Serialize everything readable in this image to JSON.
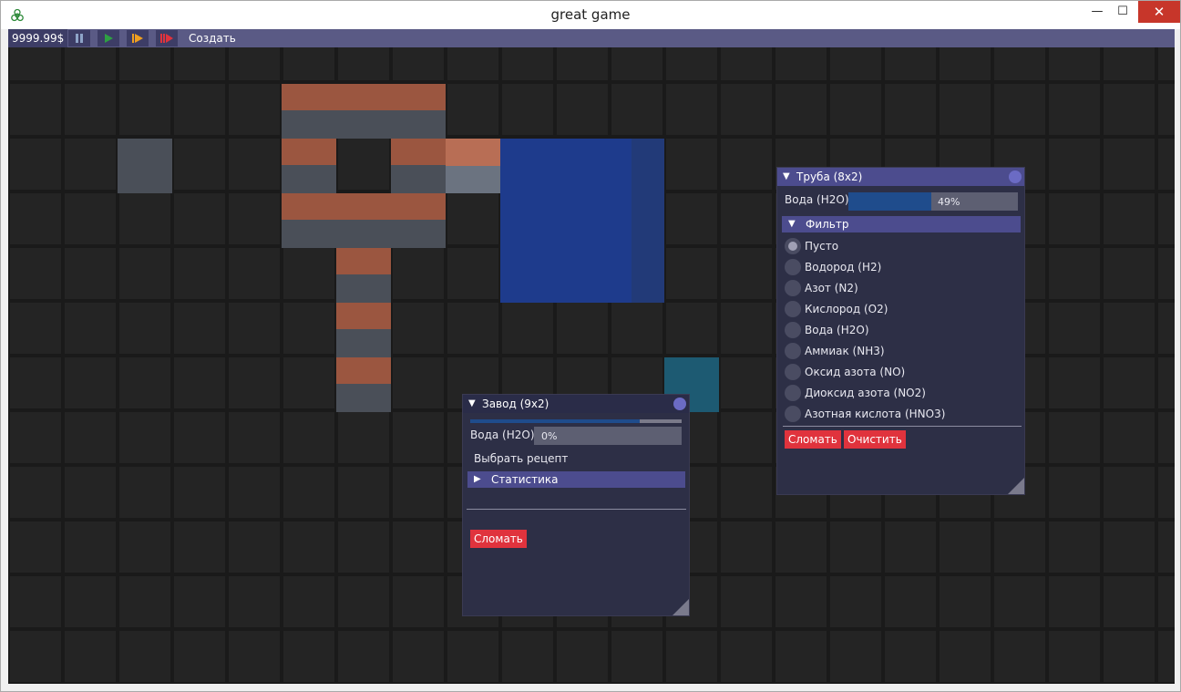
{
  "window": {
    "title": "great game",
    "minimize": "—",
    "maximize": "☐",
    "close": "✕"
  },
  "toolbar": {
    "money": "9999.99$",
    "pause_icon": "pause-icon",
    "play_icon": "play-icon",
    "fast_icon": "fast-forward-icon",
    "fastest_icon": "fastest-forward-icon",
    "create_label": "Создать",
    "colors": {
      "play": "#2ea043",
      "fast": "#f0a020",
      "fastest": "#e0333d"
    }
  },
  "pipe_panel": {
    "title": "Труба (8x2)",
    "resource_label": "Вода (H2O)",
    "fill_text": "49%",
    "fill_fraction": 0.49,
    "filter_section": "Фильтр",
    "filter_options": [
      "Пусто",
      "Водород (H2)",
      "Азот (N2)",
      "Кислород (O2)",
      "Вода (H2O)",
      "Аммиак (NH3)",
      "Оксид азота (NO)",
      "Диоксид азота (NO2)",
      "Азотная кислота (HNO3)"
    ],
    "selected_filter": 0,
    "break_label": "Сломать",
    "clear_label": "Очистить"
  },
  "factory_panel": {
    "title": "Завод (9x2)",
    "progress_fraction": 0.8,
    "resource_label": "Вода (H2O)",
    "fill_text": "0%",
    "fill_fraction": 0,
    "recipe_label": "Выбрать рецепт",
    "stats_section": "Статистика",
    "break_label": "Сломать"
  },
  "colors": {
    "grid_bg": "#242424",
    "grid_line": "#1a1a1a",
    "pipe_orange": "#9b5640",
    "pipe_gray": "#4a4f58",
    "water_tank": "#1e3b8c",
    "small_block": "#1d5a72",
    "panel_title": "#4c4c8e",
    "danger": "#e0333d"
  }
}
